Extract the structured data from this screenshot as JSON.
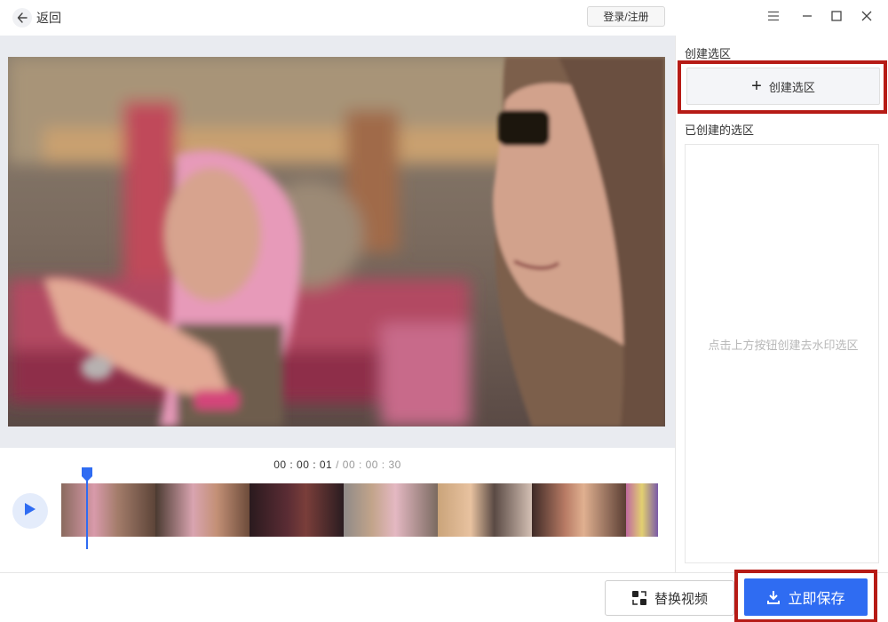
{
  "titlebar": {
    "back_label": "返回",
    "login_label": "登录/注册",
    "icons": [
      "arrow-left-icon",
      "menu-icon",
      "minimize-icon",
      "maximize-icon",
      "close-icon"
    ]
  },
  "timeline": {
    "current_time": "00 : 00 : 01",
    "separator": "/",
    "total_time": "00 : 00 : 30",
    "play_icon": "play-icon"
  },
  "panel": {
    "create_section_title": "创建选区",
    "create_button_label": "创建选区",
    "created_section_title": "已创建的选区",
    "empty_hint": "点击上方按钮创建去水印选区"
  },
  "footer": {
    "replace_video_label": "替换视频",
    "save_now_label": "立即保存"
  },
  "colors": {
    "accent": "#2f6cf2",
    "highlight_outline": "#b61b16",
    "preview_background": "#e9ebf0",
    "playhead": "#2f6cf2"
  }
}
